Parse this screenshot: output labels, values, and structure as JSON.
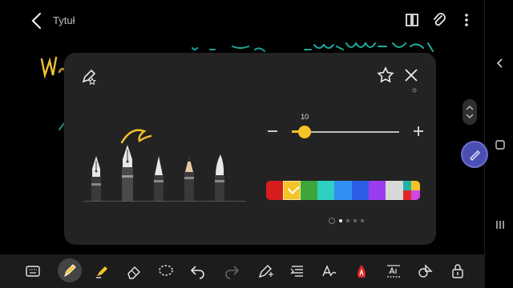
{
  "header": {
    "title": "Tytuł",
    "icons": [
      "back-icon",
      "book-icon",
      "attachment-icon",
      "more-icon"
    ]
  },
  "pen_settings": {
    "size_value": "10",
    "size_fraction": 0.12,
    "selected_pen": "fountain-pen",
    "pens": [
      "fountain-pen",
      "calligraphy-pen",
      "ballpoint-pen",
      "pencil",
      "marker"
    ],
    "colors": [
      "#d71e1e",
      "#f5c328",
      "#3ea73b",
      "#2ed1c1",
      "#2f8ff2",
      "#2c5ee5",
      "#9a3cf2",
      "#d8d8d8",
      "multicolor"
    ],
    "selected_color": "#f5c328",
    "page_dots": 5,
    "active_page_dot": 1
  },
  "toolbar": {
    "tools": [
      "keyboard-icon",
      "pen-tool-icon",
      "highlighter-icon",
      "eraser-icon",
      "lasso-icon",
      "undo-icon",
      "redo-icon",
      "pen-add-icon",
      "text-align-icon",
      "handwriting-text-icon",
      "ink-color-icon",
      "text-box-icon",
      "shapes-icon",
      "lock-icon"
    ],
    "active": "pen-tool-icon"
  },
  "rail": {
    "icons": [
      "chevron-left-icon",
      "nav-recents-icon"
    ]
  }
}
